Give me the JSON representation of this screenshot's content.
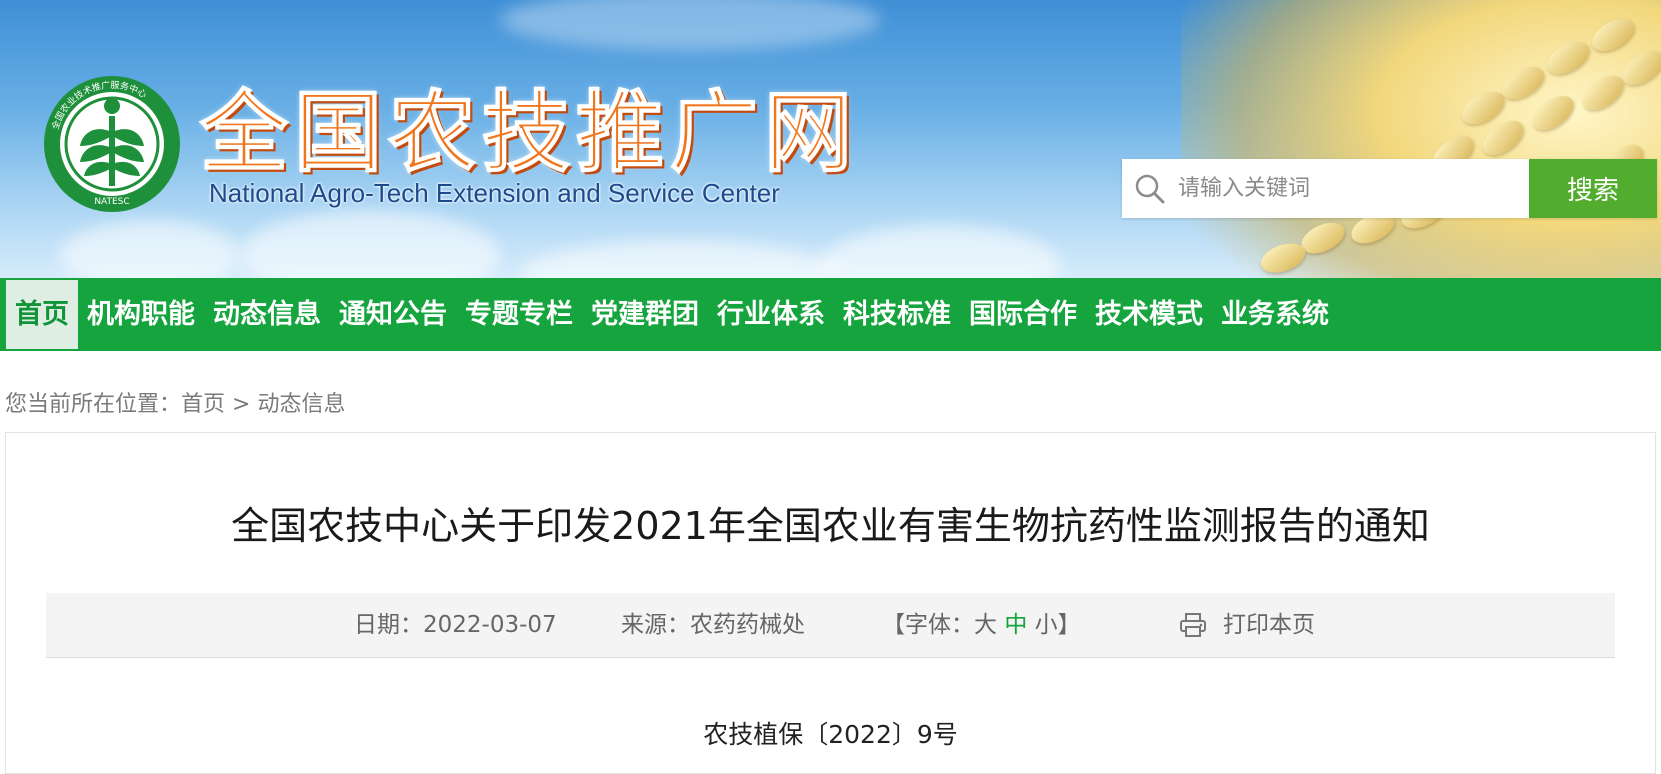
{
  "header": {
    "logo_ring_text": "全国农业技术推广服务中心",
    "logo_bottom_text": "NATESC",
    "title_cn": "全国农技推广网",
    "title_en": "National Agro-Tech Extension and Service Center"
  },
  "search": {
    "placeholder": "请输入关键词",
    "button_label": "搜索"
  },
  "nav": {
    "items": [
      {
        "label": "首页",
        "active": true
      },
      {
        "label": "机构职能"
      },
      {
        "label": "动态信息"
      },
      {
        "label": "通知公告"
      },
      {
        "label": "专题专栏"
      },
      {
        "label": "党建群团"
      },
      {
        "label": "行业体系"
      },
      {
        "label": "科技标准"
      },
      {
        "label": "国际合作"
      },
      {
        "label": "技术模式"
      },
      {
        "label": "业务系统"
      }
    ]
  },
  "breadcrumb": {
    "prefix": "您当前所在位置：",
    "home": "首页",
    "separator": " > ",
    "current": "动态信息"
  },
  "article": {
    "title": "全国农技中心关于印发2021年全国农业有害生物抗药性监测报告的通知",
    "date_label": "日期：",
    "date": "2022-03-07",
    "source_label": "来源：",
    "source": "农药药械处",
    "font_size_open": "【字体：",
    "font_large": "大",
    "font_medium": "中",
    "font_small": "小",
    "font_size_close": "】",
    "print_label": "打印本页",
    "doc_number": "农技植保〔2022〕9号"
  },
  "colors": {
    "nav_green": "#15a43e",
    "search_button_green": "#52ad2f",
    "title_orange": "#f0761d",
    "logo_green": "#1e8f3a"
  },
  "icons": {
    "search": "search-icon",
    "print": "printer-icon",
    "logo": "wheat-logo"
  }
}
